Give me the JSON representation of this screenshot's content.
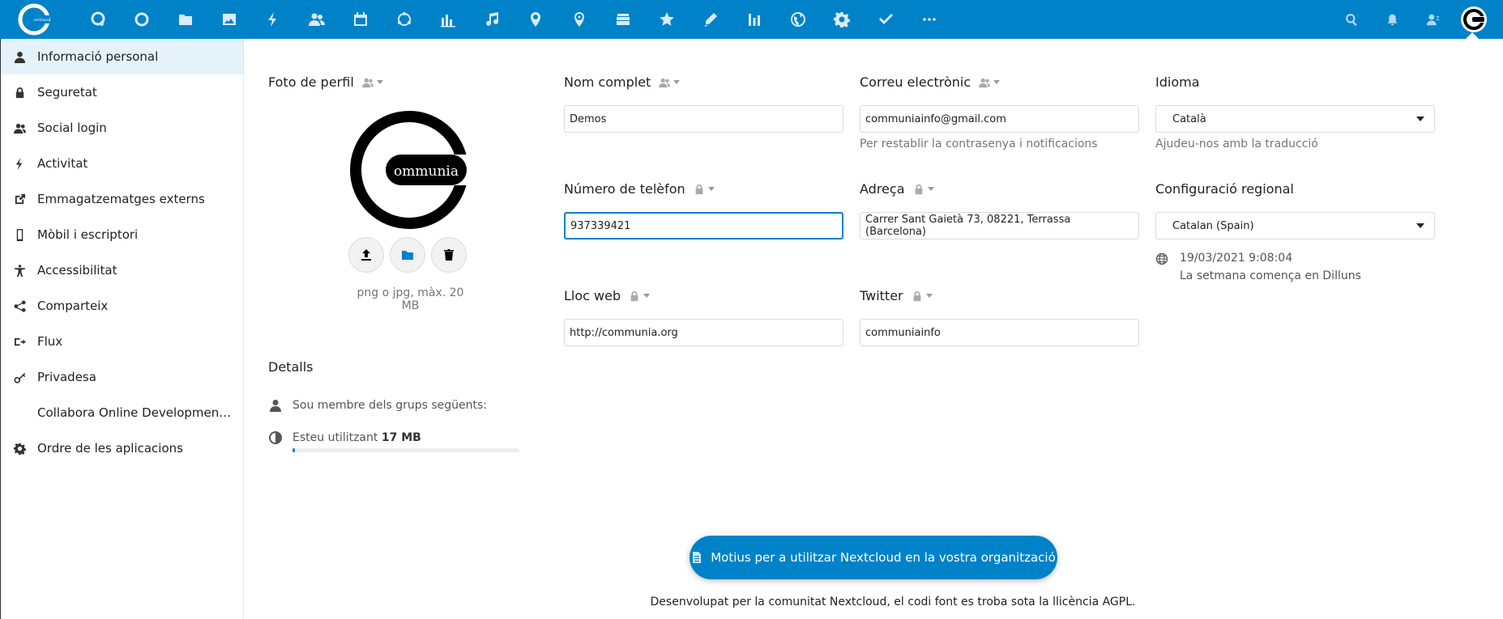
{
  "header": {
    "apps": [
      "dashboard-icon",
      "talk-icon",
      "circles-icon",
      "files-icon",
      "photos-icon",
      "activity-icon",
      "contacts-icon",
      "calendar-icon",
      "sync-icon",
      "analytics-icon",
      "music-icon",
      "maps-icon",
      "location-icon",
      "deck-icon",
      "favorites-icon",
      "notes-icon",
      "stats-icon",
      "web-icon",
      "settings-icon",
      "tasks-icon",
      "more-icon"
    ],
    "right": [
      "search-icon",
      "notifications-icon",
      "contacts-menu-icon"
    ]
  },
  "sidebar": {
    "items": [
      {
        "label": "Informació personal",
        "icon": "user-icon",
        "active": true
      },
      {
        "label": "Seguretat",
        "icon": "lock-icon"
      },
      {
        "label": "Social login",
        "icon": "group-icon"
      },
      {
        "label": "Activitat",
        "icon": "activity-icon"
      },
      {
        "label": "Emmagatzematges externs",
        "icon": "external-icon"
      },
      {
        "label": "Mòbil i escriptori",
        "icon": "phone-icon"
      },
      {
        "label": "Accessibilitat",
        "icon": "accessibility-icon"
      },
      {
        "label": "Comparteix",
        "icon": "share-icon"
      },
      {
        "label": "Flux",
        "icon": "flux-icon"
      },
      {
        "label": "Privadesa",
        "icon": "key-icon"
      },
      {
        "label": "Collabora Online Development E...",
        "icon": ""
      },
      {
        "label": "Ordre de les aplicacions",
        "icon": "gear-icon"
      }
    ]
  },
  "profile": {
    "photo_title": "Foto de perfil",
    "photo_logo_text": "ommunia",
    "photo_hint": "png o jpg, màx. 20 MB",
    "details_title": "Detalls",
    "groups_text": "Sou membre dels grups següents:",
    "usage_prefix": "Esteu utilitzant",
    "usage_value": "17 MB",
    "usage_fraction": 0.01
  },
  "fields": {
    "fullname": {
      "label": "Nom complet",
      "value": "Demos"
    },
    "email": {
      "label": "Correu electrònic",
      "value": "communiainfo@gmail.com",
      "hint": "Per restablir la contrasenya i notificacions"
    },
    "phone": {
      "label": "Número de telèfon",
      "value": "937339421"
    },
    "address": {
      "label": "Adreça",
      "value": "Carrer Sant Gaietà 73, 08221, Terrassa (Barcelona)"
    },
    "website": {
      "label": "Lloc web",
      "value": "http://communia.org"
    },
    "twitter": {
      "label": "Twitter",
      "value": "communiainfo"
    }
  },
  "language": {
    "label": "Idioma",
    "value": "Català",
    "hint": "Ajudeu-nos amb la traducció"
  },
  "locale": {
    "label": "Configuració regional",
    "value": "Catalan (Spain)",
    "datetime": "19/03/2021 9:08:04",
    "week_start": "La setmana comença en Dilluns"
  },
  "cta": {
    "label": "Motius per a utilitzar Nextcloud en la vostra organització"
  },
  "footer": {
    "text": "Desenvolupat per la comunitat Nextcloud, el codi font es troba sota la llicència AGPL."
  },
  "colors": {
    "primary": "#0082c9"
  }
}
